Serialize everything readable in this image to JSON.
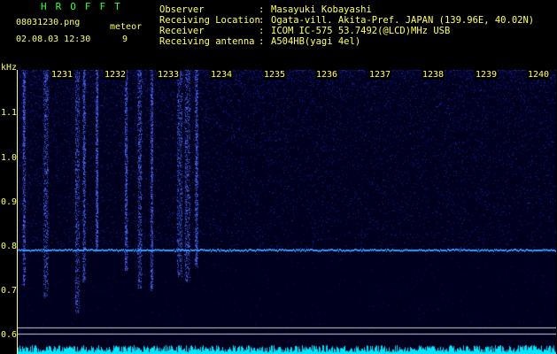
{
  "header": {
    "logo": "HROFFT",
    "filename": "08031230.png",
    "timestamp": "02.08.03 12:30",
    "meteor_label": "meteor",
    "meteor_count": "9",
    "info": [
      {
        "key": "Observer",
        "sep": ":",
        "value": "Masayuki Kobayashi"
      },
      {
        "key": "Receiving Location",
        "sep": ":",
        "value": "Ogata-vill. Akita-Pref. JAPAN (139.96E, 40.02N)"
      },
      {
        "key": "Receiver",
        "sep": ":",
        "value": "ICOM IC-575 53.7492(@LCD)MHz USB"
      },
      {
        "key": "Receiving antenna",
        "sep": ":",
        "value": "A504HB(yagi 4el)"
      }
    ]
  },
  "axes": {
    "y_unit": "kHz",
    "y_ticks": [
      {
        "label": "1.1",
        "value": 1.1
      },
      {
        "label": "1.0",
        "value": 1.0
      },
      {
        "label": "0.9",
        "value": 0.9
      },
      {
        "label": "0.8",
        "value": 0.8
      },
      {
        "label": "0.7",
        "value": 0.7
      },
      {
        "label": "0.6",
        "value": 0.6
      }
    ],
    "x_ticks": [
      "1231",
      "1232",
      "1233",
      "1234",
      "1235",
      "1236",
      "1237",
      "1238",
      "1239",
      "1240"
    ],
    "y_range": [
      0.575,
      1.2
    ]
  },
  "spectrogram": {
    "carrier_khz": 0.805,
    "meteor_streak_minutes": [
      1230.1,
      1230.5,
      1231.1,
      1231.25,
      1231.5,
      1232.05,
      1232.3,
      1232.55,
      1233.05,
      1233.2,
      1233.4
    ],
    "colors": {
      "background": "#00001e",
      "noise": "#1a2aff",
      "carrier": "#3399ff",
      "baseline": "#00e5ff",
      "reference_line": "#cccccc"
    }
  }
}
